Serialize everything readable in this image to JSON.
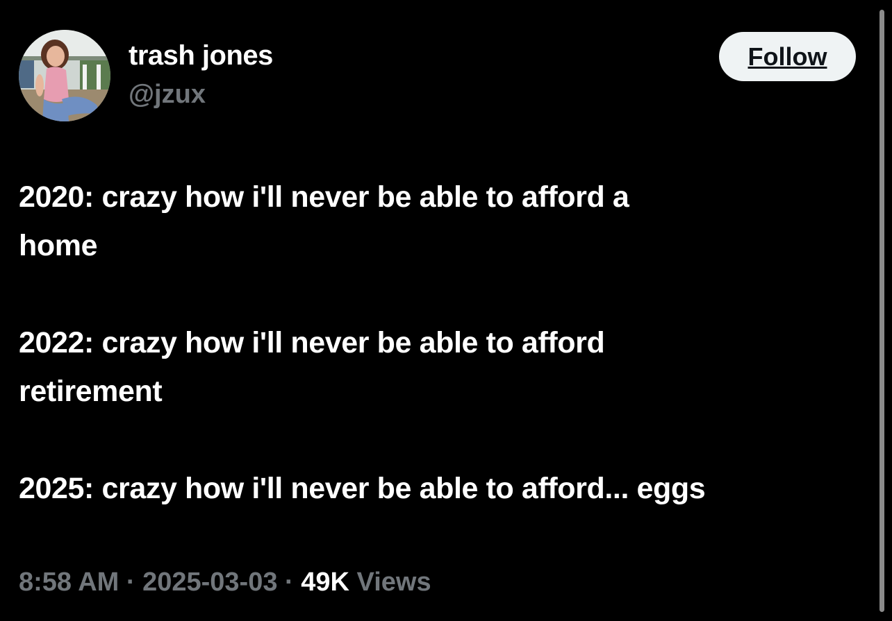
{
  "author": {
    "display_name": "trash jones",
    "handle": "@jzux",
    "avatar_icon": "profile-photo"
  },
  "follow_button": {
    "label": "Follow"
  },
  "tweet": {
    "lines": [
      "2020: crazy how i'll never be able to afford a",
      "home",
      "2022: crazy how i'll never be able to afford",
      "retirement",
      "2025: crazy how i'll never be able to afford... eggs"
    ]
  },
  "meta": {
    "time": "8:58 AM",
    "separator": "·",
    "date": "2025-03-03",
    "views_count": "49K",
    "views_label": "Views"
  },
  "colors": {
    "background": "#000000",
    "text": "#ffffff",
    "secondary_text": "#71767b",
    "button_bg": "#eff3f4",
    "button_text": "#0f1419"
  }
}
